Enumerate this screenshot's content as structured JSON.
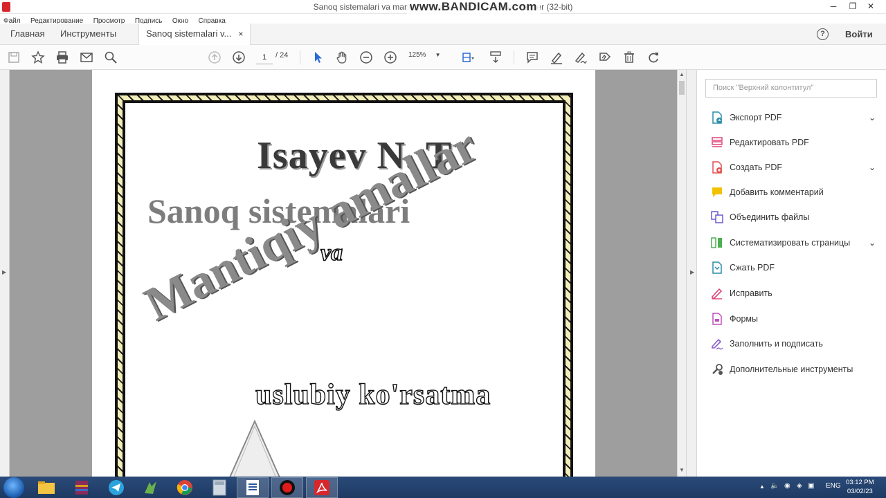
{
  "window": {
    "title": "Sanoq sistemalari va mantiqiy amallar - Adobe Acrobat Reader (32-bit)",
    "watermark": "www.BANDICAM.com"
  },
  "menubar": [
    "Файл",
    "Редактирование",
    "Просмотр",
    "Подпись",
    "Окно",
    "Справка"
  ],
  "tabs": {
    "home": "Главная",
    "tools": "Инструменты",
    "document": "Sanoq sistemalari v...",
    "close": "×",
    "signin": "Войти"
  },
  "toolbar": {
    "current_page": "1",
    "page_total": "/ 24",
    "zoom": "125%"
  },
  "document_page": {
    "author": "Isayev N. T.",
    "title_line1": "Sanoq sistemalari",
    "title_line2": "va",
    "title_line3": "Mantiqiy amallar",
    "subtitle": "uslubiy ko'rsatma"
  },
  "right_panel": {
    "search_placeholder": "Поиск \"Верхний колонтитул\"",
    "tools": [
      {
        "label": "Экспорт PDF",
        "icon": "export-pdf-icon",
        "color": "#2a8ea8",
        "expandable": true
      },
      {
        "label": "Редактировать PDF",
        "icon": "edit-pdf-icon",
        "color": "#e0457b",
        "expandable": false
      },
      {
        "label": "Создать PDF",
        "icon": "create-pdf-icon",
        "color": "#e05050",
        "expandable": true
      },
      {
        "label": "Добавить комментарий",
        "icon": "comment-icon",
        "color": "#f2c200",
        "expandable": false
      },
      {
        "label": "Объединить файлы",
        "icon": "combine-files-icon",
        "color": "#6a5acd",
        "expandable": false
      },
      {
        "label": "Систематизировать страницы",
        "icon": "organize-pages-icon",
        "color": "#4caf50",
        "expandable": true
      },
      {
        "label": "Сжать PDF",
        "icon": "compress-pdf-icon",
        "color": "#2a8ea8",
        "expandable": false
      },
      {
        "label": "Исправить",
        "icon": "fix-icon",
        "color": "#e0457b",
        "expandable": false
      },
      {
        "label": "Формы",
        "icon": "forms-icon",
        "color": "#c050c0",
        "expandable": false
      },
      {
        "label": "Заполнить и подписать",
        "icon": "fill-sign-icon",
        "color": "#8a5ad0",
        "expandable": false
      },
      {
        "label": "Дополнительные инструменты",
        "icon": "more-tools-icon",
        "color": "#555555",
        "expandable": false
      }
    ],
    "chevron": "⌄"
  },
  "taskbar": {
    "language": "ENG",
    "time": "03:12 PM",
    "date": "03/02/23"
  }
}
